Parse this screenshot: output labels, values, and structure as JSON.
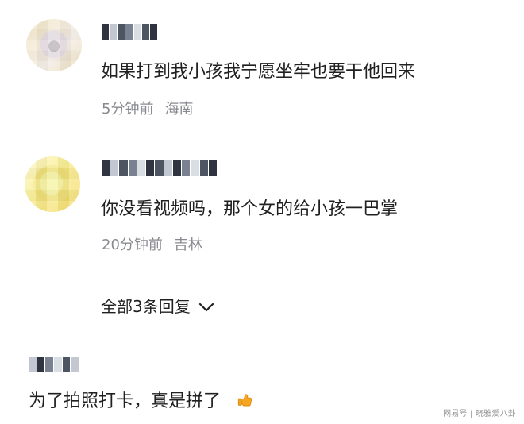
{
  "comments": [
    {
      "text": "如果打到我小孩我宁愿坐牢也要干他回来",
      "time": "5分钟前",
      "location": "海南"
    },
    {
      "text": "你没看视频吗，那个女的给小孩一巴掌",
      "time": "20分钟前",
      "location": "吉林"
    },
    {
      "text": "为了拍照打卡，真是拼了"
    }
  ],
  "replies": {
    "label": "全部3条回复"
  },
  "watermark": {
    "text": "网易号 | 晓雅爱八卦"
  },
  "icons": {
    "chevron": "chevron-down-icon",
    "reaction": "thumbs-up-icon"
  },
  "colors": {
    "text": "#202020",
    "meta": "#888a8f",
    "background": "#ffffff"
  }
}
